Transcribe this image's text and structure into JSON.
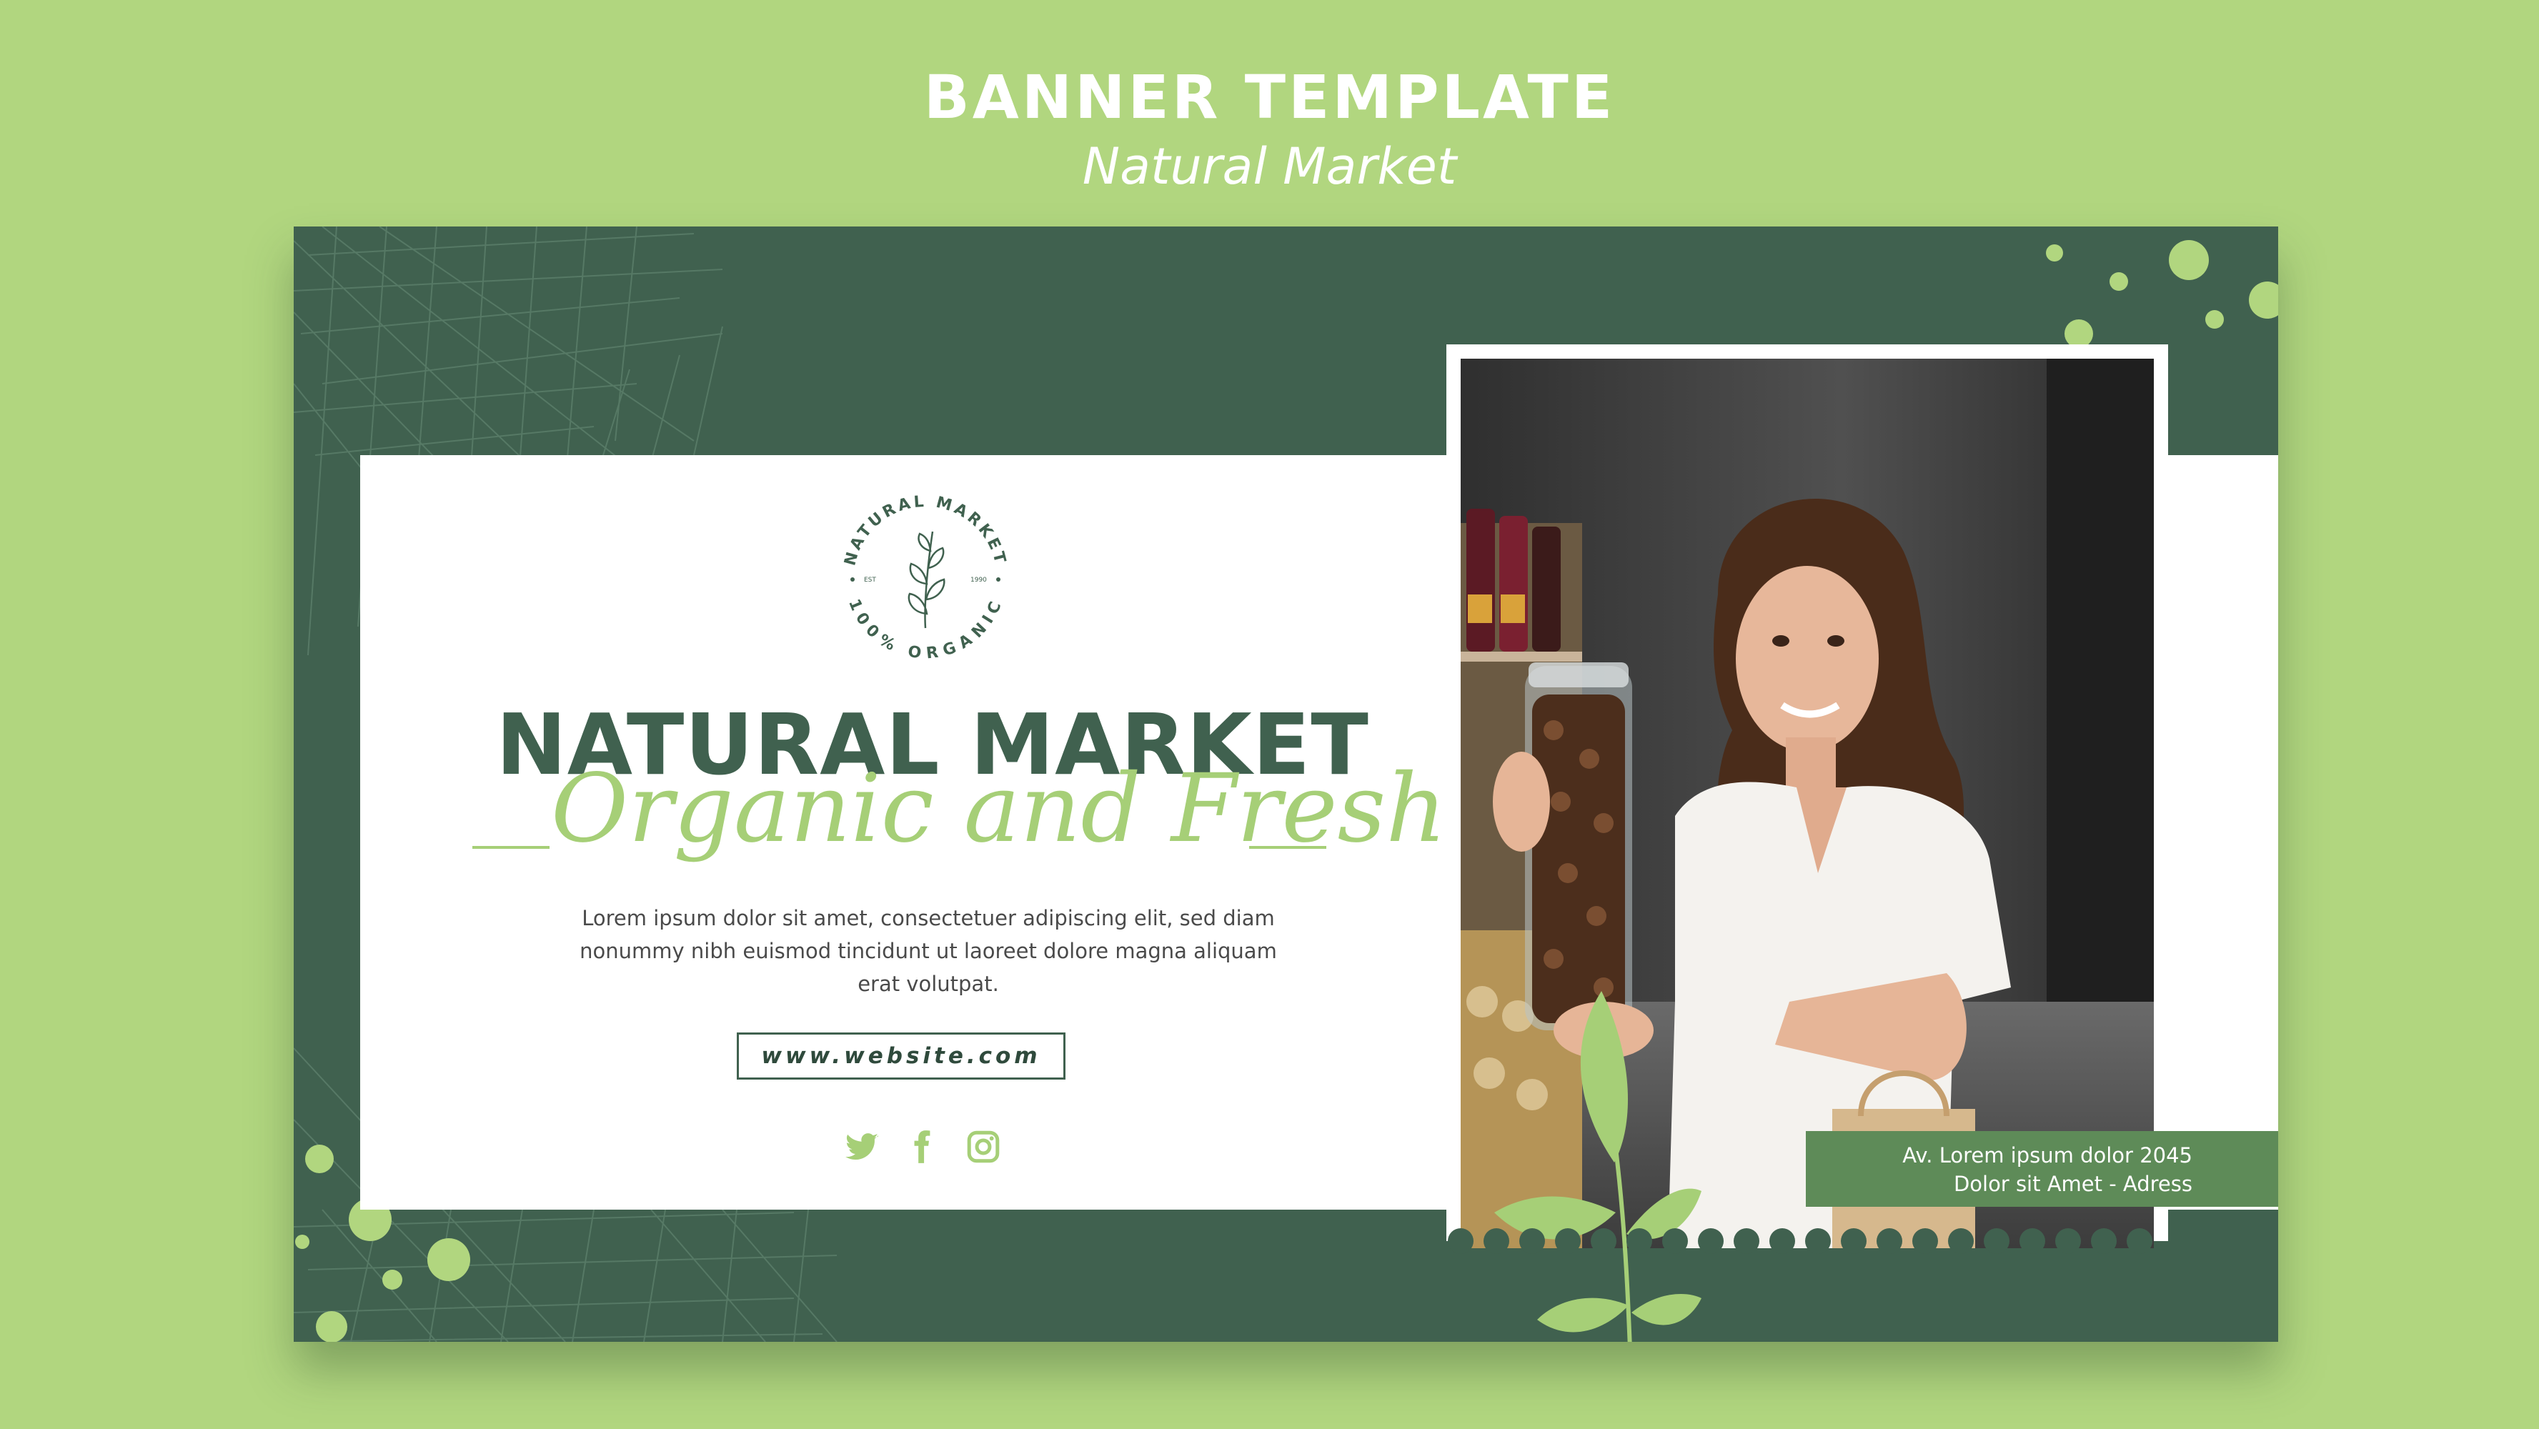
{
  "heading": {
    "title": "BANNER TEMPLATE",
    "subtitle": "Natural Market"
  },
  "badge": {
    "top_text": "NATURAL MARKET",
    "bottom_text": "100% ORGANIC",
    "left_small": "EST",
    "right_small": "1990",
    "icon": "leaf-sprig-icon"
  },
  "banner": {
    "title": "NATURAL MARKET",
    "subtitle": "Organic and Fresh",
    "body": "Lorem ipsum dolor sit amet, consectetuer adipiscing elit, sed diam nonummy nibh euismod tincidunt ut laoreet dolore magna aliquam erat volutpat.",
    "website": "www.website.com",
    "social": [
      "twitter-icon",
      "facebook-icon",
      "instagram-icon"
    ]
  },
  "address": {
    "line1": "Av. Lorem ipsum dolor 2045",
    "line2": "Dolor sit Amet - Adress"
  },
  "colors": {
    "page_background": "#b1d67f",
    "banner_dark_green": "#40614f",
    "light_green": "#a6cf77",
    "address_green": "#5e8b58",
    "white": "#ffffff"
  }
}
